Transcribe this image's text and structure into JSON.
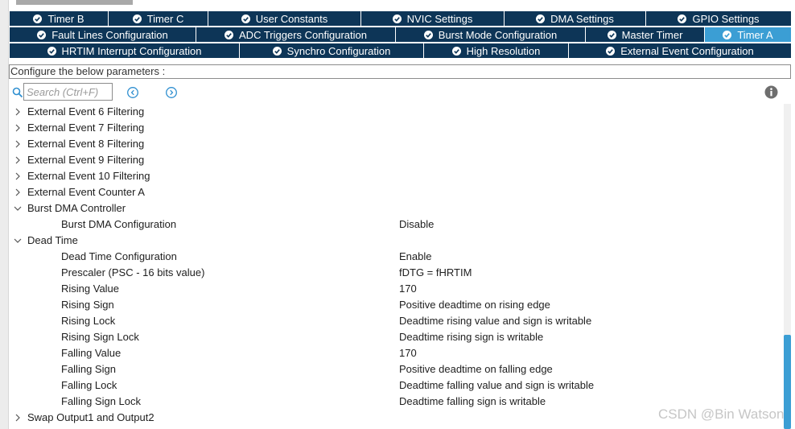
{
  "tabs": {
    "row1": [
      {
        "label": "Timer B"
      },
      {
        "label": "Timer C"
      },
      {
        "label": "User Constants"
      },
      {
        "label": "NVIC Settings"
      },
      {
        "label": "DMA Settings"
      },
      {
        "label": "GPIO Settings"
      }
    ],
    "row2": [
      {
        "label": "Fault Lines Configuration"
      },
      {
        "label": "ADC Triggers Configuration"
      },
      {
        "label": "Burst Mode Configuration"
      },
      {
        "label": "Master Timer"
      },
      {
        "label": "Timer A"
      }
    ],
    "row3": [
      {
        "label": "HRTIM Interrupt Configuration"
      },
      {
        "label": "Synchro Configuration"
      },
      {
        "label": "High Resolution"
      },
      {
        "label": "External Event Configuration"
      }
    ],
    "active_tab": "Timer A",
    "active_color": "#3b9ed4",
    "tab_color": "#0d3557"
  },
  "configure_label": "Configure the below parameters :",
  "search": {
    "placeholder": "Search (Ctrl+F)"
  },
  "icons": {
    "search": "search-icon",
    "prev": "chevron-left-circle-icon",
    "next": "chevron-right-circle-icon",
    "info": "info-icon",
    "collapsed": "chevron-right-icon",
    "expanded": "chevron-down-icon"
  },
  "tree": {
    "g1": {
      "label": "External Event 6 Filtering",
      "expanded": false
    },
    "g2": {
      "label": "External Event 7 Filtering",
      "expanded": false
    },
    "g3": {
      "label": "External Event 8 Filtering",
      "expanded": false
    },
    "g4": {
      "label": "External Event 9 Filtering",
      "expanded": false
    },
    "g5": {
      "label": "External Event 10 Filtering",
      "expanded": false
    },
    "g6": {
      "label": "External Event Counter A",
      "expanded": false
    },
    "burst": {
      "label": "Burst DMA Controller",
      "expanded": true,
      "params": [
        {
          "name": "Burst DMA Configuration",
          "value": "Disable"
        }
      ]
    },
    "dead": {
      "label": "Dead Time",
      "expanded": true,
      "params": [
        {
          "name": "Dead Time Configuration",
          "value": "Enable"
        },
        {
          "name": "Prescaler (PSC - 16 bits value)",
          "value": "fDTG = fHRTIM"
        },
        {
          "name": "Rising Value",
          "value": "170"
        },
        {
          "name": "Rising Sign",
          "value": "Positive deadtime on rising edge"
        },
        {
          "name": "Rising Lock",
          "value": "Deadtime rising value and sign is writable"
        },
        {
          "name": "Rising Sign Lock",
          "value": "Deadtime rising sign is writable"
        },
        {
          "name": "Falling Value",
          "value": "170"
        },
        {
          "name": "Falling Sign",
          "value": "Positive deadtime on falling edge"
        },
        {
          "name": "Falling Lock",
          "value": "Deadtime falling value and sign is writable"
        },
        {
          "name": "Falling Sign Lock",
          "value": "Deadtime falling sign is writable"
        }
      ]
    },
    "swap": {
      "label": "Swap Output1 and Output2",
      "expanded": false
    }
  },
  "watermark": "CSDN @Bin Watson"
}
